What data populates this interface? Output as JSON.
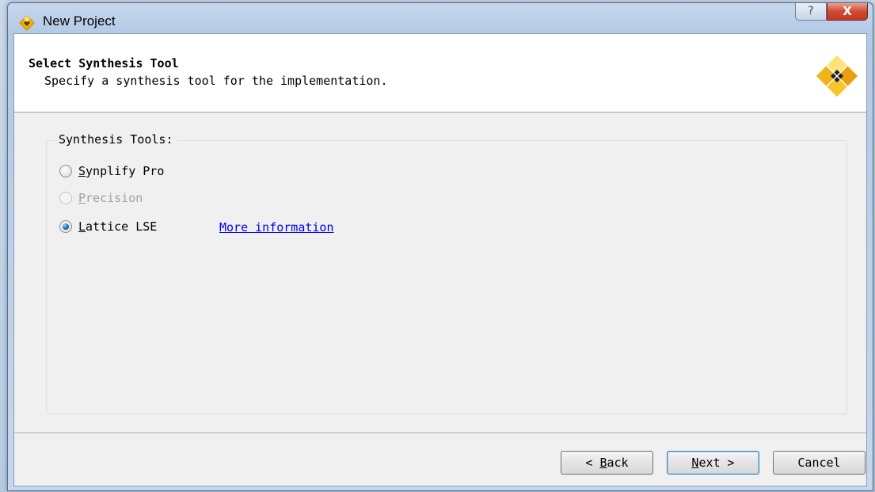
{
  "window": {
    "title": "New Project",
    "help_glyph": "?",
    "close_glyph": "X"
  },
  "header": {
    "title": "Select Synthesis Tool",
    "subtitle": "Specify a synthesis tool for the implementation."
  },
  "synthesis": {
    "group_label": "Synthesis Tools:",
    "options": [
      {
        "prefix": "",
        "mnemonic": "S",
        "rest": "ynplify Pro",
        "checked": false,
        "enabled": true
      },
      {
        "prefix": "",
        "mnemonic": "P",
        "rest": "recision",
        "checked": false,
        "enabled": false
      },
      {
        "prefix": "",
        "mnemonic": "L",
        "rest": "attice LSE",
        "checked": true,
        "enabled": true
      }
    ],
    "more_info_link": "More information"
  },
  "buttons": {
    "back": {
      "prefix": "< ",
      "mnemonic": "B",
      "rest": "ack"
    },
    "next": {
      "prefix": "",
      "mnemonic": "N",
      "rest": "ext >"
    },
    "cancel": "Cancel"
  }
}
